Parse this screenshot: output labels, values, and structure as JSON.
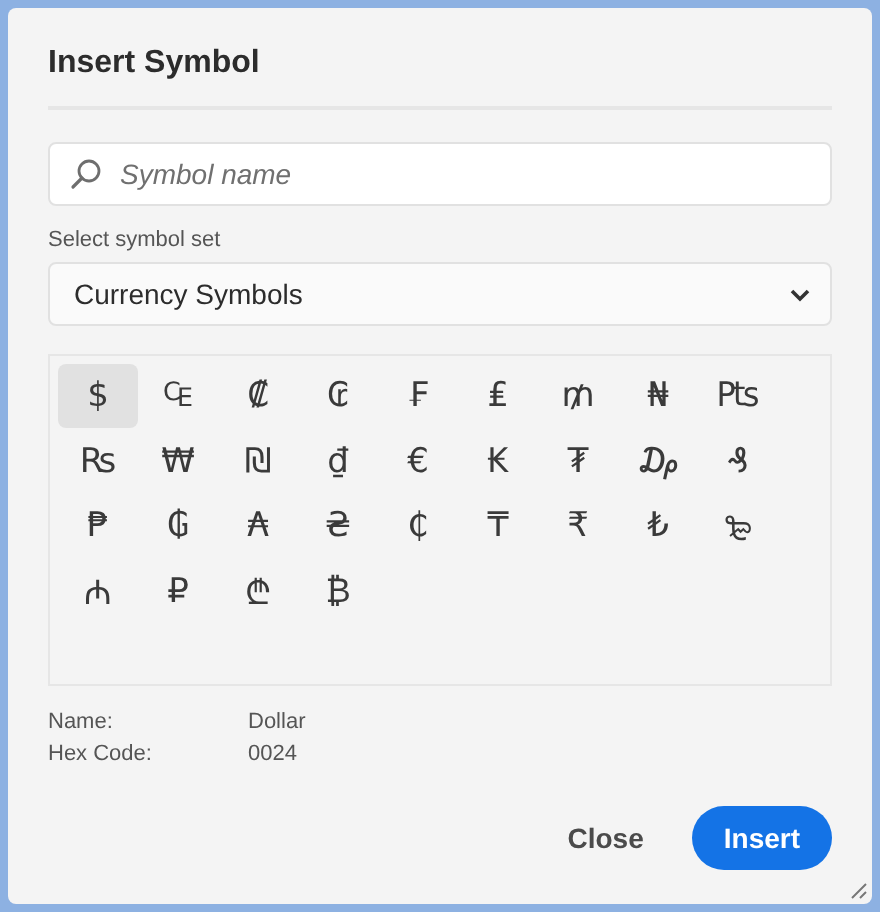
{
  "dialog": {
    "title": "Insert Symbol"
  },
  "search": {
    "placeholder": "Symbol name"
  },
  "symbol_set": {
    "label": "Select symbol set",
    "value": "Currency Symbols"
  },
  "symbols": [
    {
      "char": "$",
      "selected": true
    },
    {
      "char": "₠",
      "selected": false
    },
    {
      "char": "₡",
      "selected": false
    },
    {
      "char": "₢",
      "selected": false
    },
    {
      "char": "₣",
      "selected": false
    },
    {
      "char": "₤",
      "selected": false
    },
    {
      "char": "₥",
      "selected": false
    },
    {
      "char": "₦",
      "selected": false
    },
    {
      "char": "₧",
      "selected": false
    },
    {
      "char": "₨",
      "selected": false
    },
    {
      "char": "₩",
      "selected": false
    },
    {
      "char": "₪",
      "selected": false
    },
    {
      "char": "₫",
      "selected": false
    },
    {
      "char": "€",
      "selected": false
    },
    {
      "char": "₭",
      "selected": false
    },
    {
      "char": "₮",
      "selected": false
    },
    {
      "char": "₯",
      "selected": false
    },
    {
      "char": "₰",
      "selected": false
    },
    {
      "char": "₱",
      "selected": false
    },
    {
      "char": "₲",
      "selected": false
    },
    {
      "char": "₳",
      "selected": false
    },
    {
      "char": "₴",
      "selected": false
    },
    {
      "char": "₵",
      "selected": false
    },
    {
      "char": "₸",
      "selected": false
    },
    {
      "char": "₹",
      "selected": false
    },
    {
      "char": "₺",
      "selected": false
    },
    {
      "char": "₻",
      "selected": false
    },
    {
      "char": "₼",
      "selected": false
    },
    {
      "char": "₽",
      "selected": false
    },
    {
      "char": "₾",
      "selected": false
    },
    {
      "char": "₿",
      "selected": false
    }
  ],
  "details": [
    {
      "label": "Name:",
      "value": "Dollar"
    },
    {
      "label": "Hex Code:",
      "value": "0024"
    }
  ],
  "buttons": [
    {
      "label": "Close",
      "kind": "secondary"
    },
    {
      "label": "Insert",
      "kind": "primary"
    }
  ]
}
